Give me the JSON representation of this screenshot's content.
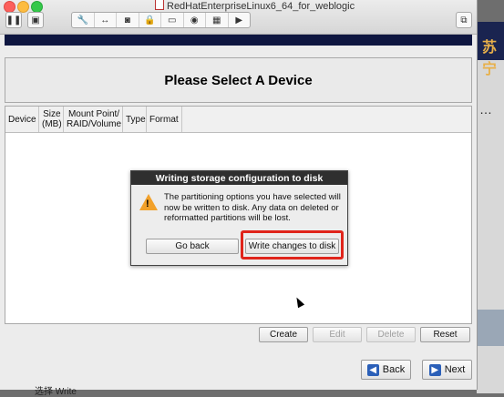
{
  "window": {
    "title": "RedHatEnterpriseLinux6_64_for_weblogic",
    "toolbar_icons": [
      "wrench-icon",
      "arrows-icon",
      "disk-icon",
      "lock-icon",
      "hdd-icon",
      "camera-icon",
      "image-icon",
      "play-icon"
    ]
  },
  "background": {
    "corner_text": "苏宁",
    "ellipsis": "…",
    "bottom_text": "选择 Write"
  },
  "page": {
    "heading": "Please Select A Device"
  },
  "table": {
    "columns": [
      "Device",
      "Size (MB)",
      "Mount Point/ RAID/Volume",
      "Type",
      "Format"
    ],
    "rows": []
  },
  "actions": {
    "create": "Create",
    "edit": "Edit",
    "delete": "Delete",
    "reset": "Reset"
  },
  "nav": {
    "back": "Back",
    "next": "Next"
  },
  "dialog": {
    "title": "Writing storage configuration to disk",
    "message": "The partitioning options you have selected will now be written to disk.  Any data on deleted or reformatted partitions will be lost.",
    "go_back": "Go back",
    "write": "Write changes to disk"
  },
  "colors": {
    "highlight": "#e0241b",
    "dialog_title_bg": "#2f2f2f",
    "warning": "#f2a12b"
  }
}
